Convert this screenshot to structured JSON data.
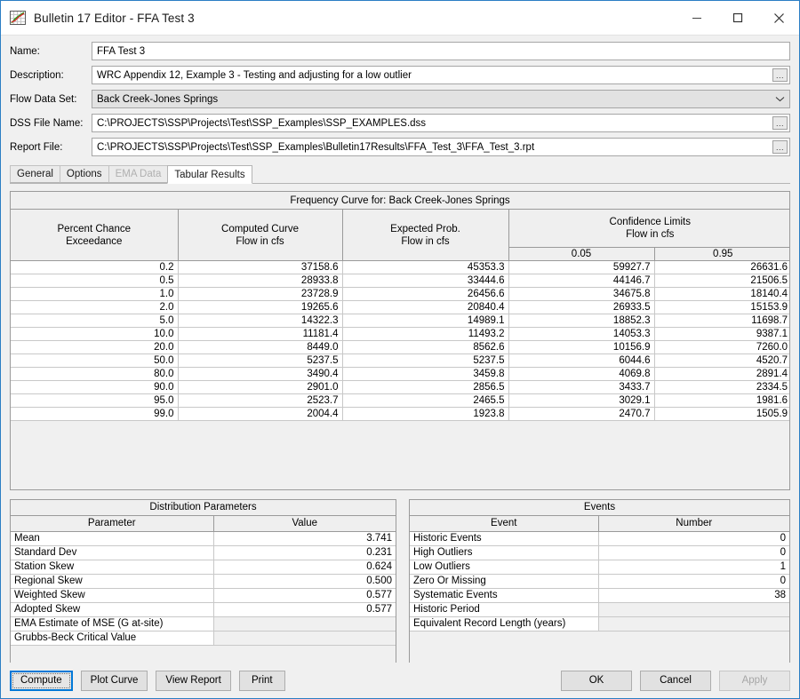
{
  "window": {
    "title": "Bulletin 17 Editor - FFA Test 3",
    "icon": "chart-icon",
    "controls": {
      "minimize": "minimize-icon",
      "maximize": "maximize-icon",
      "close": "close-icon"
    }
  },
  "form": {
    "name": {
      "label": "Name:",
      "value": "FFA Test 3"
    },
    "description": {
      "label": "Description:",
      "value": "WRC Appendix 12, Example 3 - Testing and adjusting for a low outlier",
      "browse": "..."
    },
    "flow_data_set": {
      "label": "Flow Data Set:",
      "value": "Back Creek-Jones Springs"
    },
    "dss_file_name": {
      "label": "DSS File Name:",
      "value": "C:\\PROJECTS\\SSP\\Projects\\Test\\SSP_Examples\\SSP_EXAMPLES.dss",
      "browse": "..."
    },
    "report_file": {
      "label": "Report File:",
      "value": "C:\\PROJECTS\\SSP\\Projects\\Test\\SSP_Examples\\Bulletin17Results\\FFA_Test_3\\FFA_Test_3.rpt",
      "browse": "..."
    }
  },
  "tabs": [
    {
      "label": "General",
      "state": "normal"
    },
    {
      "label": "Options",
      "state": "normal"
    },
    {
      "label": "EMA Data",
      "state": "disabled"
    },
    {
      "label": "Tabular Results",
      "state": "active"
    }
  ],
  "frequency_table": {
    "title": "Frequency Curve for: Back Creek-Jones Springs",
    "headers": {
      "percent_chance": "Percent Chance\nExceedance",
      "percent_chance_l1": "Percent Chance",
      "percent_chance_l2": "Exceedance",
      "computed_l1": "Computed Curve",
      "computed_l2": "Flow in cfs",
      "expected_l1": "Expected Prob.",
      "expected_l2": "Flow in cfs",
      "confidence_l1": "Confidence Limits",
      "confidence_l2": "Flow in cfs",
      "conf_low": "0.05",
      "conf_high": "0.95"
    },
    "rows": [
      {
        "pct": "0.2",
        "computed": "37158.6",
        "expected": "45353.3",
        "cl05": "59927.7",
        "cl95": "26631.6"
      },
      {
        "pct": "0.5",
        "computed": "28933.8",
        "expected": "33444.6",
        "cl05": "44146.7",
        "cl95": "21506.5"
      },
      {
        "pct": "1.0",
        "computed": "23728.9",
        "expected": "26456.6",
        "cl05": "34675.8",
        "cl95": "18140.4"
      },
      {
        "pct": "2.0",
        "computed": "19265.6",
        "expected": "20840.4",
        "cl05": "26933.5",
        "cl95": "15153.9"
      },
      {
        "pct": "5.0",
        "computed": "14322.3",
        "expected": "14989.1",
        "cl05": "18852.3",
        "cl95": "11698.7"
      },
      {
        "pct": "10.0",
        "computed": "11181.4",
        "expected": "11493.2",
        "cl05": "14053.3",
        "cl95": "9387.1"
      },
      {
        "pct": "20.0",
        "computed": "8449.0",
        "expected": "8562.6",
        "cl05": "10156.9",
        "cl95": "7260.0"
      },
      {
        "pct": "50.0",
        "computed": "5237.5",
        "expected": "5237.5",
        "cl05": "6044.6",
        "cl95": "4520.7"
      },
      {
        "pct": "80.0",
        "computed": "3490.4",
        "expected": "3459.8",
        "cl05": "4069.8",
        "cl95": "2891.4"
      },
      {
        "pct": "90.0",
        "computed": "2901.0",
        "expected": "2856.5",
        "cl05": "3433.7",
        "cl95": "2334.5"
      },
      {
        "pct": "95.0",
        "computed": "2523.7",
        "expected": "2465.5",
        "cl05": "3029.1",
        "cl95": "1981.6"
      },
      {
        "pct": "99.0",
        "computed": "2004.4",
        "expected": "1923.8",
        "cl05": "2470.7",
        "cl95": "1505.9"
      }
    ]
  },
  "distribution_parameters": {
    "title": "Distribution Parameters",
    "col_param": "Parameter",
    "col_value": "Value",
    "rows": [
      {
        "name": "Mean",
        "value": "3.741"
      },
      {
        "name": "Standard Dev",
        "value": "0.231"
      },
      {
        "name": "Station Skew",
        "value": "0.624"
      },
      {
        "name": "Regional Skew",
        "value": "0.500"
      },
      {
        "name": "Weighted Skew",
        "value": "0.577"
      },
      {
        "name": "Adopted Skew",
        "value": "0.577"
      },
      {
        "name": "EMA Estimate of MSE (G at-site)",
        "value": ""
      },
      {
        "name": "Grubbs-Beck Critical Value",
        "value": ""
      }
    ]
  },
  "events": {
    "title": "Events",
    "col_event": "Event",
    "col_number": "Number",
    "rows": [
      {
        "name": "Historic Events",
        "value": "0"
      },
      {
        "name": "High Outliers",
        "value": "0"
      },
      {
        "name": "Low Outliers",
        "value": "1"
      },
      {
        "name": "Zero Or Missing",
        "value": "0"
      },
      {
        "name": "Systematic Events",
        "value": "38"
      },
      {
        "name": "Historic Period",
        "value": ""
      },
      {
        "name": "Equivalent Record Length (years)",
        "value": ""
      }
    ]
  },
  "buttons": {
    "compute": "Compute",
    "plot_curve": "Plot Curve",
    "view_report": "View Report",
    "print": "Print",
    "ok": "OK",
    "cancel": "Cancel",
    "apply": "Apply"
  },
  "colors": {
    "window_border": "#2b7ec4",
    "focus_accent": "#0078d7",
    "panel_bg": "#f0f0f0",
    "header_bg": "#efefef"
  }
}
